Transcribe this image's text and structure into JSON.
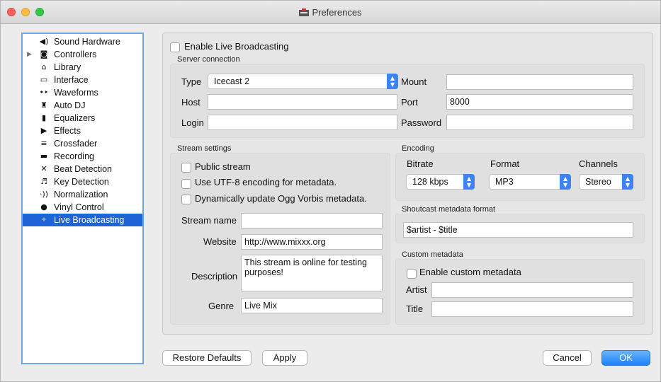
{
  "window": {
    "title": "Preferences"
  },
  "sidebar": {
    "items": [
      {
        "label": "Sound Hardware",
        "icon": "speaker-icon",
        "glyph": "◀)"
      },
      {
        "label": "Controllers",
        "icon": "controller-icon",
        "glyph": "◙"
      },
      {
        "label": "Library",
        "icon": "library-icon",
        "glyph": "⌂"
      },
      {
        "label": "Interface",
        "icon": "monitor-icon",
        "glyph": "▭"
      },
      {
        "label": "Waveforms",
        "icon": "waveform-icon",
        "glyph": "•‣"
      },
      {
        "label": "Auto DJ",
        "icon": "robot-icon",
        "glyph": "♜"
      },
      {
        "label": "Equalizers",
        "icon": "equalizer-icon",
        "glyph": "▮"
      },
      {
        "label": "Effects",
        "icon": "effects-icon",
        "glyph": "▶"
      },
      {
        "label": "Crossfader",
        "icon": "crossfader-icon",
        "glyph": "≡"
      },
      {
        "label": "Recording",
        "icon": "recording-icon",
        "glyph": "▬"
      },
      {
        "label": "Beat Detection",
        "icon": "beat-detection-icon",
        "glyph": "✕"
      },
      {
        "label": "Key Detection",
        "icon": "key-detection-icon",
        "glyph": "♬"
      },
      {
        "label": "Normalization",
        "icon": "normalization-icon",
        "glyph": "·))"
      },
      {
        "label": "Vinyl Control",
        "icon": "vinyl-icon",
        "glyph": "●"
      },
      {
        "label": "Live Broadcasting",
        "icon": "broadcast-icon",
        "glyph": "✦"
      }
    ],
    "selected": "Live Broadcasting"
  },
  "main": {
    "enable_label": "Enable Live Broadcasting",
    "server": {
      "title": "Server connection",
      "type_label": "Type",
      "type_value": "Icecast 2",
      "mount_label": "Mount",
      "mount_value": "",
      "host_label": "Host",
      "host_value": "",
      "port_label": "Port",
      "port_value": "8000",
      "login_label": "Login",
      "login_value": "",
      "password_label": "Password",
      "password_value": ""
    },
    "stream": {
      "title": "Stream settings",
      "public_label": "Public stream",
      "utf8_label": "Use UTF-8 encoding for metadata.",
      "ogg_label": "Dynamically update Ogg Vorbis metadata.",
      "name_label": "Stream name",
      "name_value": "",
      "website_label": "Website",
      "website_value": "http://www.mixxx.org",
      "description_label": "Description",
      "description_value": "This stream is online for testing purposes!",
      "genre_label": "Genre",
      "genre_value": "Live Mix"
    },
    "encoding": {
      "title": "Encoding",
      "bitrate_label": "Bitrate",
      "bitrate_value": "128 kbps",
      "format_label": "Format",
      "format_value": "MP3",
      "channels_label": "Channels",
      "channels_value": "Stereo"
    },
    "shoutcast": {
      "title": "Shoutcast metadata format",
      "value": "$artist - $title"
    },
    "custom": {
      "title": "Custom metadata",
      "enable_label": "Enable custom metadata",
      "artist_label": "Artist",
      "artist_value": "",
      "title_label": "Title",
      "title_value": ""
    }
  },
  "buttons": {
    "restore": "Restore Defaults",
    "apply": "Apply",
    "cancel": "Cancel",
    "ok": "OK"
  },
  "colors": {
    "accent": "#1e64d6",
    "close": "#fc605c",
    "minimize": "#fdbc40",
    "zoom": "#34c84a"
  }
}
